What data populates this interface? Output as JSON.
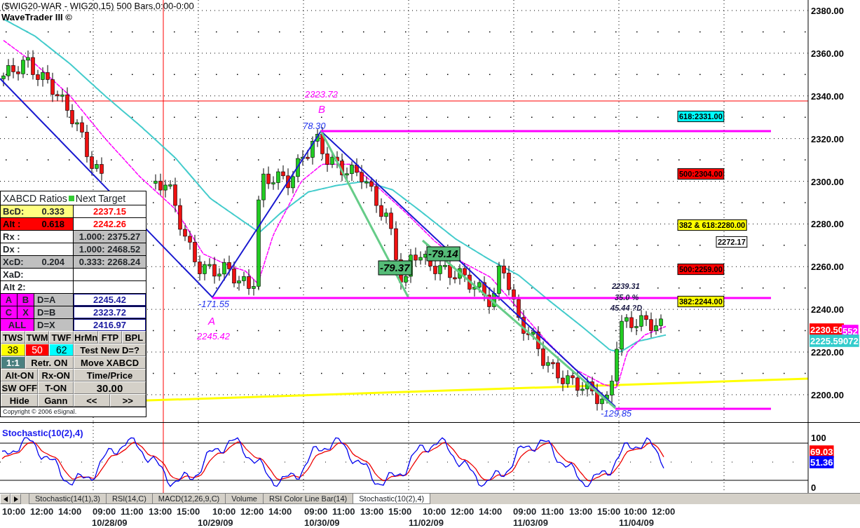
{
  "title": "($WIG20-WAR - WIG20,15) 500 Bars,0:00-0:00",
  "subtitle": "WaveTrader III ©",
  "price_axis": [
    "2380.00",
    "2360.00",
    "2340.00",
    "2320.00",
    "2300.00",
    "2280.00",
    "2260.00",
    "2240.00",
    "2220.00",
    "2200.00"
  ],
  "price_tags": [
    {
      "text": "2230.50",
      "color": "#ff0000"
    },
    {
      "text": "552",
      "color": "#ff00ff"
    },
    {
      "text": "2225.59072",
      "color": "#33cccc"
    }
  ],
  "pattern_labels": [
    {
      "text": "2323.72",
      "kind": "text",
      "color": "#ff00ff"
    },
    {
      "text": "B",
      "kind": "text",
      "color": "#ff00ff"
    },
    {
      "text": "78.30",
      "kind": "text",
      "color": "#2233ee"
    },
    {
      "text": "-171.55",
      "kind": "text",
      "color": "#2233ee"
    },
    {
      "text": "A",
      "kind": "text",
      "color": "#ff00ff"
    },
    {
      "text": "2245.42",
      "kind": "text",
      "color": "#ff00ff"
    },
    {
      "text": "-79.37",
      "kind": "boxed",
      "color": "#55bb77"
    },
    {
      "text": "-79.14",
      "kind": "boxed",
      "color": "#55bb77"
    },
    {
      "text": "2239.31",
      "kind": "text",
      "color": "#1a1a44"
    },
    {
      "text": "35.0 %",
      "kind": "text",
      "color": "#1a1a44"
    },
    {
      "text": "45.44 ?D",
      "kind": "text",
      "color": "#1a1a44"
    },
    {
      "text": "-129.85",
      "kind": "text",
      "color": "#2233ee"
    }
  ],
  "level_labels": [
    {
      "text": "618:2331.00",
      "color": "#00ffff"
    },
    {
      "text": "500:2304.00",
      "color": "#ff0000"
    },
    {
      "text": "382 & 618:2280.00",
      "color": "#ffff00"
    },
    {
      "text": "2272.17",
      "color": "#ffffff"
    },
    {
      "text": "500:2259.00",
      "color": "#ff0000"
    },
    {
      "text": "382:2244.00",
      "color": "#ffff00"
    }
  ],
  "panel": {
    "title": "XABCD Ratios",
    "target_title": "Next Target",
    "ratio_rows": [
      {
        "label": "BcD:",
        "value": "0.333",
        "color": "#ffff80",
        "target": "2237.15",
        "kind": "alert"
      },
      {
        "label": "Alt  :",
        "value": "0.618",
        "color": "#ff0000",
        "target": "2242.26",
        "kind": "alert"
      },
      {
        "label": "Rx  :",
        "target": "1.000: 2375.27",
        "kind": "computed"
      },
      {
        "label": "Dx  :",
        "target": "1.000: 2468.52",
        "kind": "computed"
      },
      {
        "label": "XcD:",
        "value": "0.204",
        "color": "#c0c0c0",
        "target": "0.333: 2268.24",
        "kind": "computed"
      },
      {
        "label": "XaD:",
        "kind": "empty"
      },
      {
        "label": "Alt 2:",
        "kind": "empty"
      }
    ],
    "point_rows": [
      {
        "points": [
          "A",
          "B"
        ],
        "mode": "D=A",
        "target": "2245.42"
      },
      {
        "points": [
          "C",
          "X"
        ],
        "mode": "D=B",
        "target": "2323.72"
      },
      {
        "points": [
          "ALL"
        ],
        "mode": "D=X",
        "target": "2416.97"
      }
    ],
    "button_rows": [
      [
        {
          "label": "TWS",
          "kind": "button"
        },
        {
          "label": "TWM",
          "kind": "button"
        },
        {
          "label": "TWF",
          "kind": "button"
        },
        {
          "label": "HrMn",
          "kind": "button"
        },
        {
          "label": "FTP",
          "kind": "button"
        },
        {
          "label": "BPL",
          "kind": "button"
        }
      ],
      [
        {
          "label": "38",
          "kind": "swatch",
          "color": "#ffff00"
        },
        {
          "label": "50",
          "kind": "swatch",
          "color": "#ff0000"
        },
        {
          "label": "62",
          "kind": "swatch",
          "color": "#00ffff"
        },
        {
          "label": "Test New D=?",
          "kind": "button"
        }
      ],
      [
        {
          "label": "1:1",
          "kind": "active"
        },
        {
          "label": "Retr. ON",
          "kind": "button"
        },
        {
          "label": "Move XABCD",
          "kind": "button"
        }
      ],
      [
        {
          "label": "Alt-ON",
          "kind": "button"
        },
        {
          "label": "Rx-ON",
          "kind": "button"
        },
        {
          "label": "Time/Price",
          "kind": "button"
        }
      ],
      [
        {
          "label": "SW OFF",
          "kind": "button"
        },
        {
          "label": "T-ON",
          "kind": "button"
        },
        {
          "label": "30.00",
          "kind": "value"
        }
      ],
      [
        {
          "label": "Hide",
          "kind": "button"
        },
        {
          "label": "Gann",
          "kind": "button"
        },
        {
          "label": "<<",
          "kind": "button"
        },
        {
          "label": ">>",
          "kind": "button"
        }
      ]
    ],
    "copyright": "Copyright © 2006 eSignal."
  },
  "stochastic": {
    "title": "Stochastic(10(2),4)",
    "axis": [
      "100",
      "0"
    ],
    "tags": [
      {
        "text": "69.03",
        "color": "#ff0000"
      },
      {
        "text": "51.36",
        "color": "#0000ff"
      }
    ]
  },
  "tabs": [
    {
      "label": "Stochastic(14(1),3)",
      "selected": false
    },
    {
      "label": "RSI(14,C)",
      "selected": false
    },
    {
      "label": "MACD(12,26,9,C)",
      "selected": false
    },
    {
      "label": "Volume",
      "selected": false
    },
    {
      "label": "RSI Color Line Bar(14)",
      "selected": false
    },
    {
      "label": "Stochastic(10(2),4)",
      "selected": true
    }
  ],
  "time_axis": [
    {
      "times": [
        "10:00",
        "12:00",
        "14:00"
      ]
    },
    {
      "date": "10/28/09",
      "times": [
        "09:00",
        "11:00",
        "13:00",
        "15:00"
      ]
    },
    {
      "date": "10/29/09",
      "times": [
        "10:00",
        "12:00",
        "14:00"
      ]
    },
    {
      "date": "10/30/09",
      "times": [
        "09:00",
        "11:00",
        "13:00",
        "15:00"
      ]
    },
    {
      "date": "11/02/09",
      "times": [
        "10:00",
        "12:00",
        "14:00"
      ]
    },
    {
      "date": "11/03/09",
      "times": [
        "09:00",
        "11:00",
        "13:00",
        "15:00"
      ]
    },
    {
      "date": "11/04/09",
      "times": [
        "10:00",
        "12:00"
      ]
    }
  ]
}
